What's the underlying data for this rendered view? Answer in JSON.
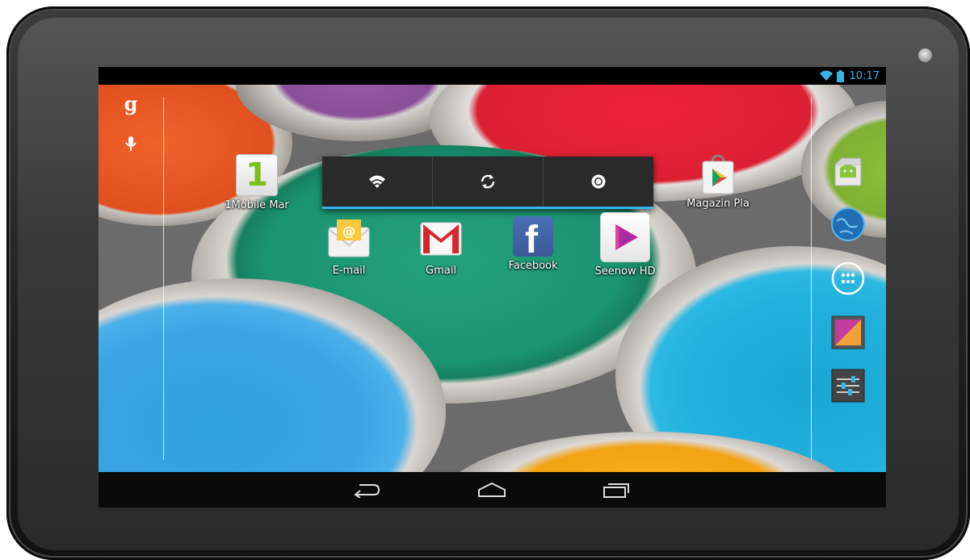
{
  "status_bar": {
    "time": "10:17",
    "icons": [
      "wifi-icon",
      "battery-icon"
    ],
    "accent": "#33b5e5"
  },
  "search": {
    "google_glyph": "g",
    "icons": [
      "google-search-icon",
      "mic-icon"
    ]
  },
  "quick_settings": {
    "items": [
      {
        "name": "wifi-toggle",
        "icon": "wifi-icon"
      },
      {
        "name": "sync-toggle",
        "icon": "sync-icon"
      },
      {
        "name": "brightness-toggle",
        "icon": "brightness-icon"
      }
    ]
  },
  "apps": {
    "mobile_market": {
      "label": "1Mobile Mar",
      "glyph": "1"
    },
    "play_store": {
      "label": "Magazin Pla"
    },
    "email": {
      "label": "E-mail"
    },
    "gmail": {
      "label": "Gmail"
    },
    "facebook": {
      "label": "Facebook",
      "glyph": "f"
    },
    "seenow": {
      "label": "Seenow HD"
    }
  },
  "dock": [
    "apk-installer-icon",
    "browser-globe-icon",
    "all-apps-icon",
    "gallery-icon",
    "settings-icon"
  ],
  "nav_bar": [
    "back-icon",
    "home-icon",
    "recents-icon"
  ]
}
